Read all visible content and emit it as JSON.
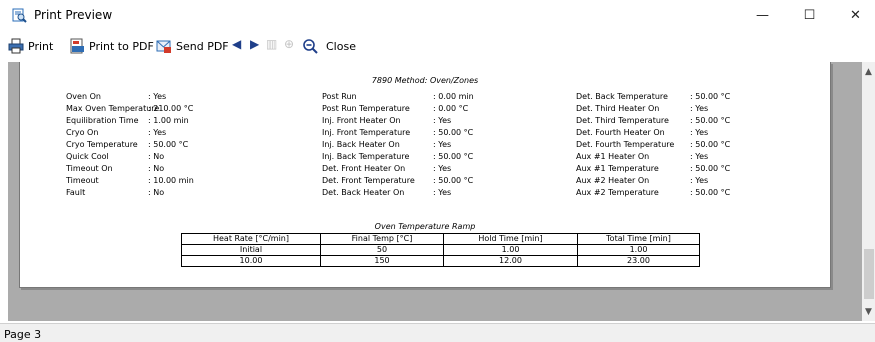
{
  "window": {
    "title": "Print Preview",
    "minimize": "—",
    "maximize": "☐",
    "close": "✕"
  },
  "toolbar": {
    "print": "Print",
    "print_to_pdf": "Print to PDF",
    "send_pdf": "Send PDF",
    "close": "Close"
  },
  "page": {
    "section_title": "7890 Method: Oven/Zones",
    "columns": [
      [
        [
          "Oven On",
          ": Yes"
        ],
        [
          "Max Oven Temperature",
          ": 210.00 °C"
        ],
        [
          "Equilibration Time",
          ": 1.00 min"
        ],
        [
          "Cryo On",
          ": Yes"
        ],
        [
          "Cryo Temperature",
          ": 50.00 °C"
        ],
        [
          "Quick Cool",
          ": No"
        ],
        [
          "Timeout On",
          ": No"
        ],
        [
          "Timeout",
          ": 10.00 min"
        ],
        [
          "Fault",
          ": No"
        ]
      ],
      [
        [
          "Post Run",
          ": 0.00 min"
        ],
        [
          "Post Run Temperature",
          ": 0.00 °C"
        ],
        [
          "Inj. Front Heater On",
          ": Yes"
        ],
        [
          "Inj. Front Temperature",
          ": 50.00 °C"
        ],
        [
          "Inj. Back Heater On",
          ": Yes"
        ],
        [
          "Inj. Back Temperature",
          ": 50.00 °C"
        ],
        [
          "Det. Front Heater On",
          ": Yes"
        ],
        [
          "Det. Front Temperature",
          ": 50.00 °C"
        ],
        [
          "Det. Back Heater On",
          ": Yes"
        ]
      ],
      [
        [
          "Det. Back Temperature",
          ": 50.00 °C"
        ],
        [
          "Det. Third Heater On",
          ": Yes"
        ],
        [
          "Det. Third Temperature",
          ": 50.00 °C"
        ],
        [
          "Det. Fourth Heater On",
          ": Yes"
        ],
        [
          "Det. Fourth Temperature",
          ": 50.00 °C"
        ],
        [
          "Aux #1 Heater On",
          ": Yes"
        ],
        [
          "Aux #1 Temperature",
          ": 50.00 °C"
        ],
        [
          "Aux #2 Heater On",
          ": Yes"
        ],
        [
          "Aux #2 Temperature",
          ": 50.00 °C"
        ]
      ]
    ],
    "ramp": {
      "title": "Oven Temperature Ramp",
      "headers": [
        "Heat Rate [°C/min]",
        "Final Temp [°C]",
        "Hold Time [min]",
        "Total Time [min]"
      ],
      "rows": [
        [
          "Initial",
          "50",
          "1.00",
          "1.00"
        ],
        [
          "10.00",
          "150",
          "12.00",
          "23.00"
        ]
      ]
    }
  },
  "status": {
    "page": "Page 3"
  },
  "colors": {
    "viewport_bg": "#ababab",
    "arrow_blue": "#1f3f8a"
  }
}
